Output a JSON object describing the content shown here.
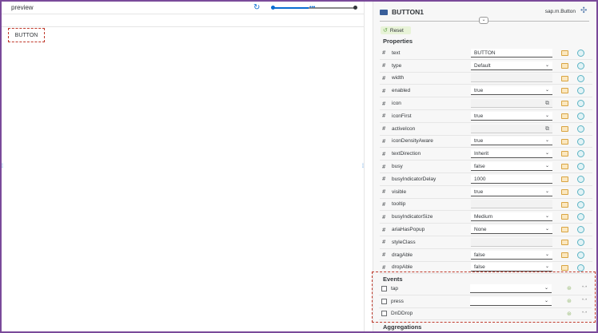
{
  "preview": {
    "title": "preview",
    "button_label": "BUTTON"
  },
  "panel": {
    "control_name": "BUTTON1",
    "control_type": "sap.m.Button",
    "reset_label": "Reset",
    "properties_title": "Properties",
    "events_title": "Events",
    "aggregations_title": "Aggregations"
  },
  "properties": [
    {
      "name": "text",
      "value": "BUTTON",
      "kind": "text"
    },
    {
      "name": "type",
      "value": "Default",
      "kind": "select"
    },
    {
      "name": "width",
      "value": "",
      "kind": "text"
    },
    {
      "name": "enabled",
      "value": "true",
      "kind": "select"
    },
    {
      "name": "icon",
      "value": "",
      "kind": "picker"
    },
    {
      "name": "iconFirst",
      "value": "true",
      "kind": "select"
    },
    {
      "name": "activeIcon",
      "value": "",
      "kind": "picker"
    },
    {
      "name": "iconDensityAware",
      "value": "true",
      "kind": "select"
    },
    {
      "name": "textDirection",
      "value": "Inherit",
      "kind": "select"
    },
    {
      "name": "busy",
      "value": "false",
      "kind": "select"
    },
    {
      "name": "busyIndicatorDelay",
      "value": "1000",
      "kind": "text"
    },
    {
      "name": "visible",
      "value": "true",
      "kind": "select"
    },
    {
      "name": "tooltip",
      "value": "",
      "kind": "text"
    },
    {
      "name": "busyIndicatorSize",
      "value": "Medium",
      "kind": "select"
    },
    {
      "name": "ariaHasPopup",
      "value": "None",
      "kind": "select"
    },
    {
      "name": "styleClass",
      "value": "",
      "kind": "text"
    },
    {
      "name": "dragAble",
      "value": "false",
      "kind": "select"
    },
    {
      "name": "dropAble",
      "value": "false",
      "kind": "select"
    }
  ],
  "events": [
    {
      "name": "tap",
      "value": ""
    },
    {
      "name": "press",
      "value": ""
    },
    {
      "name": "DnDDrop",
      "value": ""
    }
  ]
}
